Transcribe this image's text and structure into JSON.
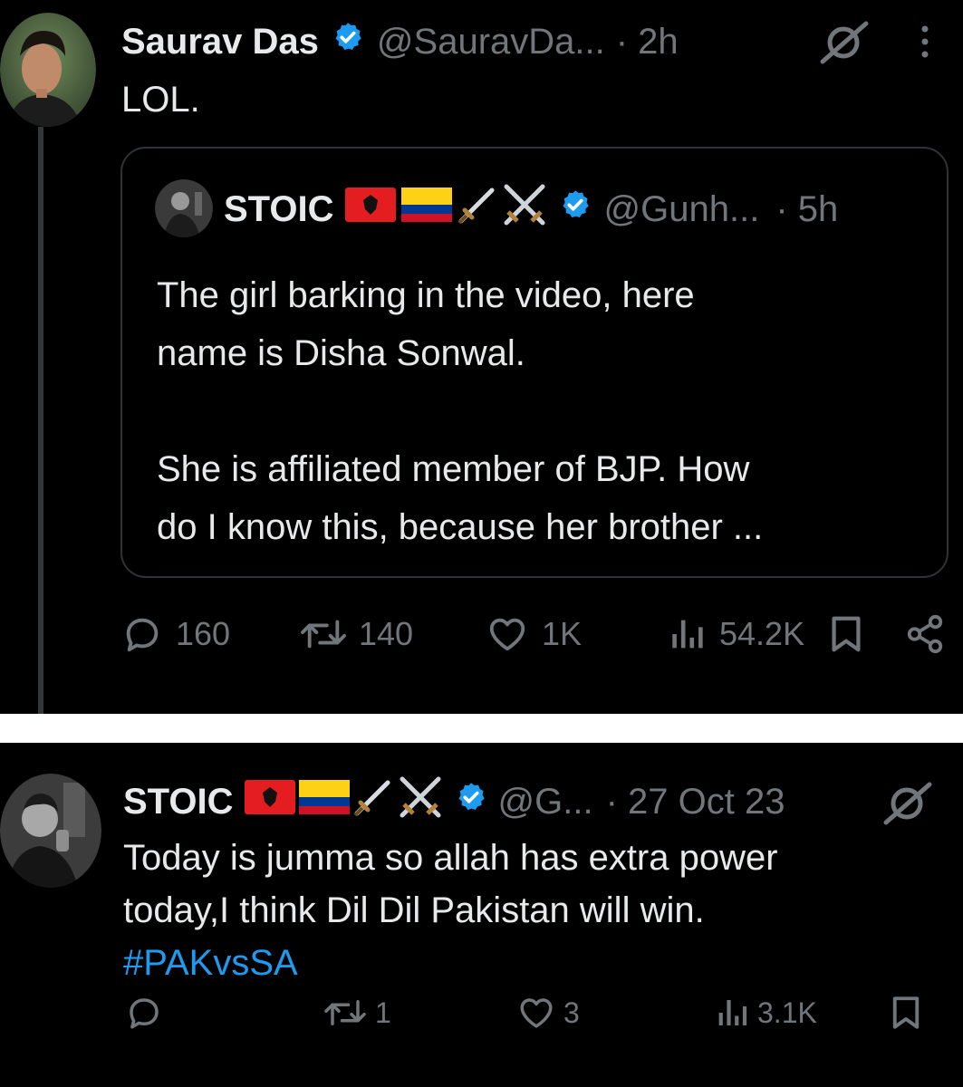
{
  "tweet1": {
    "author_name": "Saurav Das",
    "author_handle": "@SauravDa...",
    "time": "· 2h",
    "text": "LOL.",
    "quote": {
      "author_name": "STOIC",
      "author_handle": "@Gunh...",
      "time": "· 5h",
      "text_line1": "The girl barking in the video, here",
      "text_line2": "name is Disha Sonwal.",
      "text_line3": "She is affiliated member of BJP. How",
      "text_line4": "do I know this, because her brother ..."
    },
    "actions": {
      "replies": "160",
      "reposts": "140",
      "likes": "1K",
      "views": "54.2K"
    }
  },
  "tweet2": {
    "author_name": "STOIC",
    "author_handle": "@G...",
    "time": "· 27 Oct 23",
    "text_line1": "Today is jumma so allah has extra power",
    "text_line2": "today,I think Dil Dil Pakistan will win.",
    "hashtag": "#PAKvsSA",
    "actions": {
      "replies": "",
      "reposts": "1",
      "likes": "3",
      "views": "3.1K"
    }
  },
  "icons": [
    "verified-badge-icon",
    "grok-icon",
    "more-icon",
    "albania-flag-icon",
    "colombia-flag-icon",
    "dagger-icon",
    "crossed-swords-icon",
    "reply-icon",
    "repost-icon",
    "like-icon",
    "views-icon",
    "bookmark-icon",
    "share-icon"
  ],
  "colors": {
    "background": "#000000",
    "text": "#e7e9ea",
    "muted": "#71767b",
    "accent": "#1d9bf0",
    "border": "#2f3336"
  }
}
